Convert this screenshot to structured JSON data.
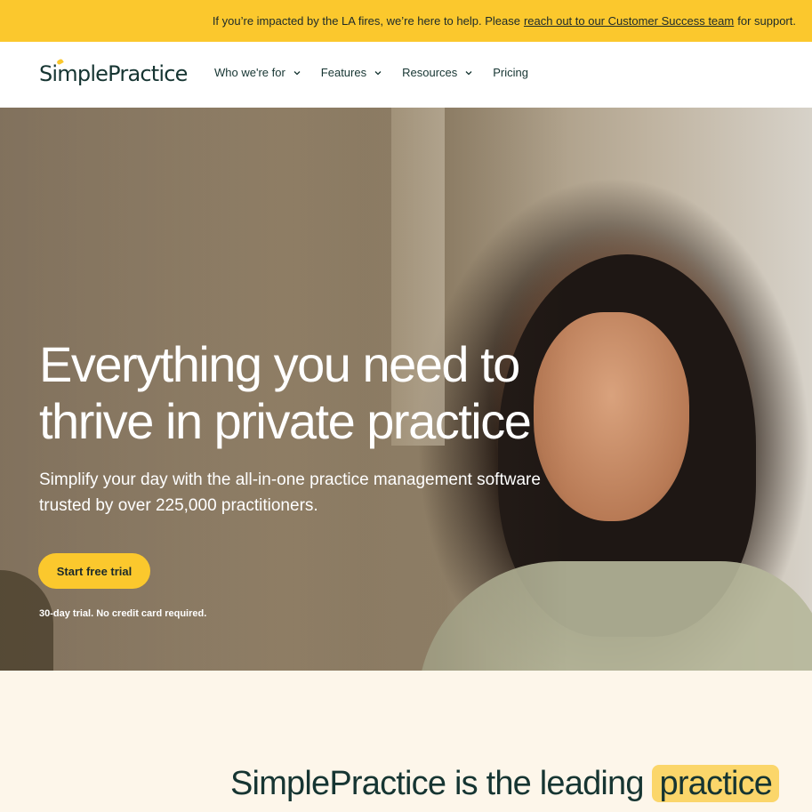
{
  "banner": {
    "text_before": "If you’re impacted by the LA fires, we’re here to help. Please",
    "link": "reach out to our Customer Success team",
    "text_after": "for support."
  },
  "header": {
    "logo": "SimplePractice",
    "nav": [
      {
        "label": "Who we're for",
        "has_dropdown": true
      },
      {
        "label": "Features",
        "has_dropdown": true
      },
      {
        "label": "Resources",
        "has_dropdown": true
      },
      {
        "label": "Pricing",
        "has_dropdown": false
      }
    ]
  },
  "hero": {
    "title_line1": "Everything you need to",
    "title_line2": "thrive in private practice",
    "subtitle_line1": "Simplify your day with the all-in-one practice management software",
    "subtitle_line2": "trusted by over 225,000 practitioners.",
    "cta_label": "Start free trial",
    "note": "30-day trial. No credit card required."
  },
  "section": {
    "heading_prefix": "SimplePractice is the leading",
    "heading_highlight": "practice"
  },
  "colors": {
    "accent": "#fbc82d",
    "brand_dark": "#163532",
    "cream": "#fdf6ea"
  }
}
